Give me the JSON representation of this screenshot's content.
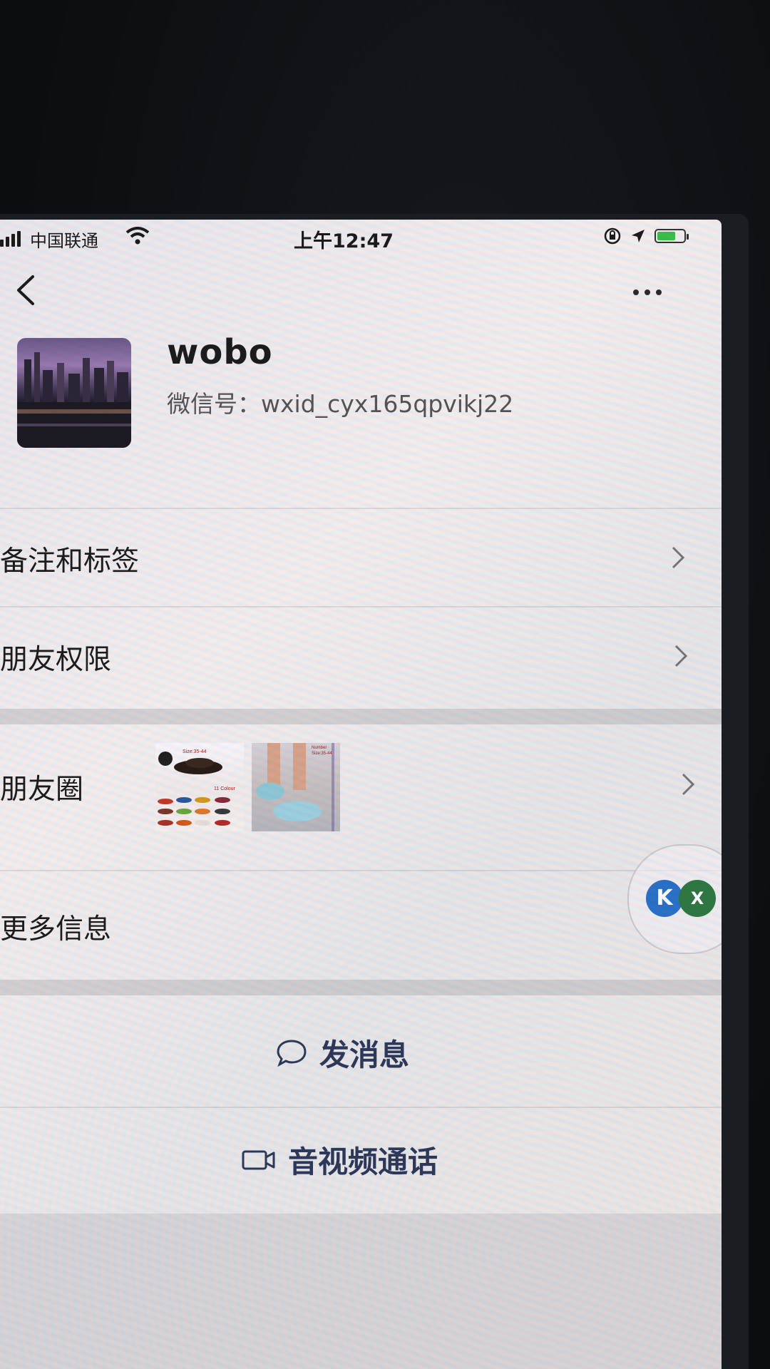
{
  "status_bar": {
    "carrier": "中国联通",
    "time": "上午12:47",
    "icons": [
      "signal-icon",
      "wifi-icon",
      "rotation-lock-icon",
      "location-icon",
      "battery-charging-icon"
    ]
  },
  "nav": {
    "back_icon": "chevron-left-icon",
    "more_icon": "more-dots-icon"
  },
  "profile": {
    "name": "wobo",
    "wechat_id": "微信号：wxid_cyx165qpvikj22"
  },
  "menu": {
    "items": [
      {
        "label": "备注和标签"
      },
      {
        "label": "朋友权限"
      },
      {
        "label": "朋友圈"
      },
      {
        "label": "更多信息"
      }
    ],
    "moments_thumb_texts": [
      "Size:35-44",
      "11 Colour",
      "Number",
      "Size:35-44"
    ]
  },
  "floating_bubble": {
    "k": "K",
    "x": "X"
  },
  "actions": {
    "send_message": "发消息",
    "video_call": "音视频通话"
  },
  "colors": {
    "action_text": "#2e3a5a",
    "battery": "#3bc24a",
    "bubble_k": "#2b73c6",
    "bubble_x": "#2f7a42"
  }
}
